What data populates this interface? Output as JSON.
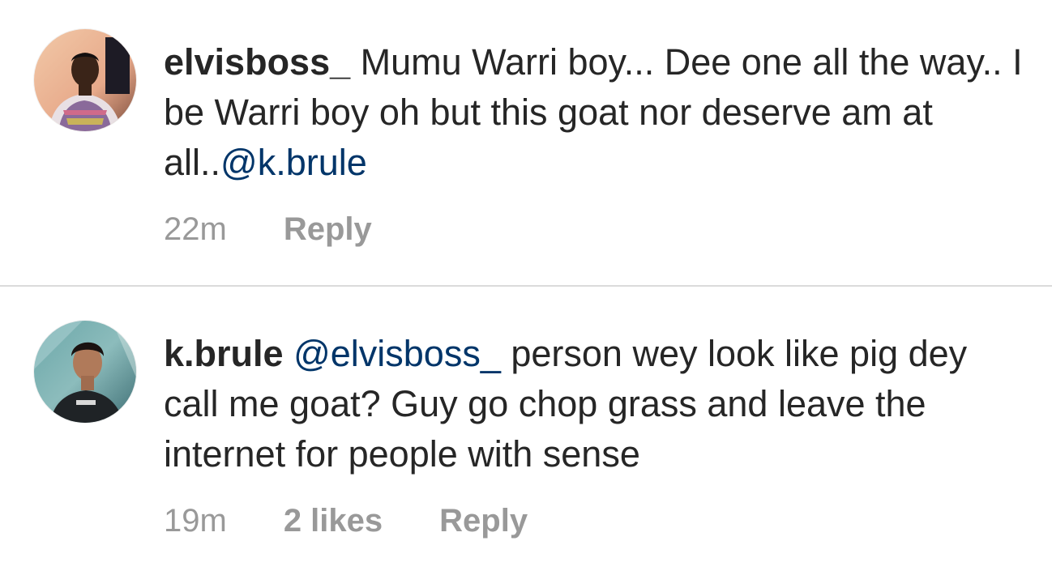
{
  "comments": [
    {
      "username": "elvisboss_",
      "text_before": " Mumu Warri boy... Dee one all the way.. I be Warri boy oh but this goat nor deserve am at all..",
      "mention": "@k.brule",
      "text_after": "",
      "time": "22m",
      "likes": "",
      "reply_label": "Reply"
    },
    {
      "username": "k.brule",
      "text_before": " ",
      "mention": "@elvisboss_",
      "text_after": " person wey look like pig dey call me goat? Guy go chop grass and leave the internet for people with sense",
      "time": "19m",
      "likes": "2 likes",
      "reply_label": "Reply"
    }
  ],
  "colors": {
    "text": "#262626",
    "mention": "#003569",
    "meta": "#999999",
    "divider": "#dbdbdb"
  }
}
